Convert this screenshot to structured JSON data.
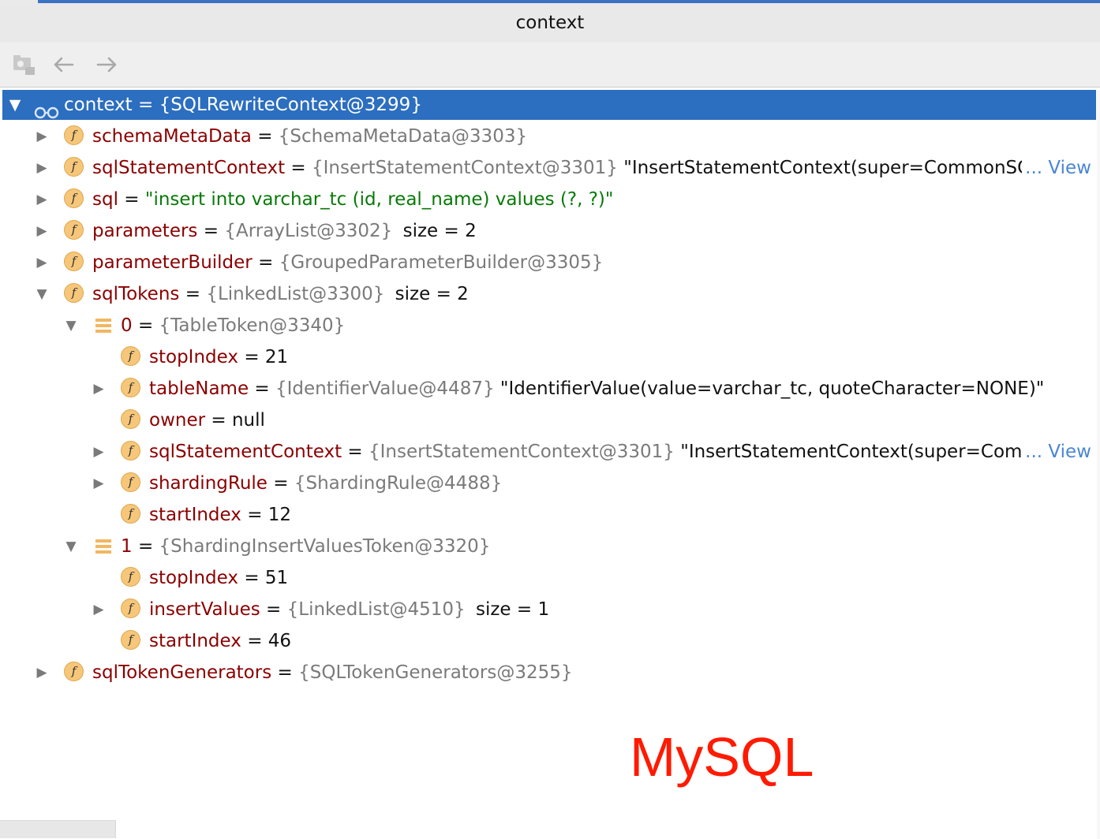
{
  "window": {
    "title": "context"
  },
  "tree": {
    "root": {
      "name": "context",
      "type": "{SQLRewriteContext@3299}"
    },
    "schemaMetaData": {
      "name": "schemaMetaData",
      "type": "{SchemaMetaData@3303}"
    },
    "sqlStatementContext": {
      "name": "sqlStatementContext",
      "type": "{InsertStatementContext@3301}",
      "value": "\"InsertStatementContext(super=CommonSQLS",
      "view": "... View"
    },
    "sql": {
      "name": "sql",
      "value": "\"insert into varchar_tc (id, real_name) values (?, ?)\""
    },
    "parameters": {
      "name": "parameters",
      "type": "{ArrayList@3302}",
      "size": "size = 2"
    },
    "parameterBuilder": {
      "name": "parameterBuilder",
      "type": "{GroupedParameterBuilder@3305}"
    },
    "sqlTokens": {
      "name": "sqlTokens",
      "type": "{LinkedList@3300}",
      "size": "size = 2"
    },
    "token0": {
      "index": "0",
      "type": "{TableToken@3340}",
      "stopIndex": {
        "name": "stopIndex",
        "value": "21"
      },
      "tableName": {
        "name": "tableName",
        "type": "{IdentifierValue@4487}",
        "value": "\"IdentifierValue(value=varchar_tc, quoteCharacter=NONE)\""
      },
      "owner": {
        "name": "owner",
        "value": "null"
      },
      "sqlStatementContext": {
        "name": "sqlStatementContext",
        "type": "{InsertStatementContext@3301}",
        "value": "\"InsertStatementContext(super=Commc",
        "view": "... View"
      },
      "shardingRule": {
        "name": "shardingRule",
        "type": "{ShardingRule@4488}"
      },
      "startIndex": {
        "name": "startIndex",
        "value": "12"
      }
    },
    "token1": {
      "index": "1",
      "type": "{ShardingInsertValuesToken@3320}",
      "stopIndex": {
        "name": "stopIndex",
        "value": "51"
      },
      "insertValues": {
        "name": "insertValues",
        "type": "{LinkedList@4510}",
        "size": "size = 1"
      },
      "startIndex": {
        "name": "startIndex",
        "value": "46"
      }
    },
    "sqlTokenGenerators": {
      "name": "sqlTokenGenerators",
      "type": "{SQLTokenGenerators@3255}"
    }
  },
  "watermark": "MySQL",
  "icons": {
    "field": "field-icon",
    "list": "list-element-icon",
    "watch": "glasses-icon",
    "expanded": "triangle-down",
    "collapsed": "triangle-right"
  },
  "colors": {
    "selection": "#2c6ebf",
    "name": "#8b0000",
    "type": "#7a7a7a",
    "string": "#077a07",
    "link": "#4a86d1",
    "watermark": "#ff1a00"
  }
}
